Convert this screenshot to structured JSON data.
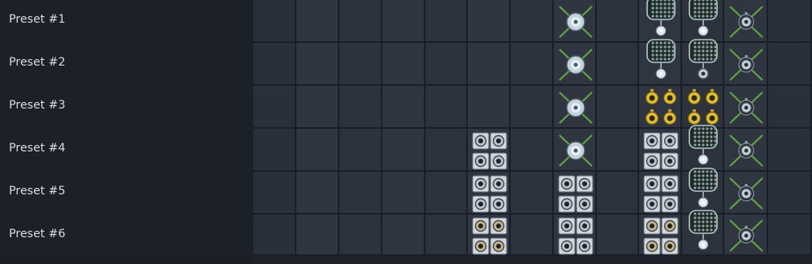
{
  "presets": [
    {
      "label": "Preset #1"
    },
    {
      "label": "Preset #2"
    },
    {
      "label": "Preset #3"
    },
    {
      "label": "Preset #4"
    },
    {
      "label": "Preset #5"
    },
    {
      "label": "Preset #6"
    }
  ],
  "placements": [
    {
      "col": 7,
      "row": 0,
      "icon": "x-knob"
    },
    {
      "col": 7,
      "row": 1,
      "icon": "x-knob"
    },
    {
      "col": 7,
      "row": 2,
      "icon": "x-knob"
    },
    {
      "col": 7,
      "row": 3,
      "icon": "x-knob"
    },
    {
      "col": 9,
      "row": 0,
      "icon": "grille"
    },
    {
      "col": 9,
      "row": 1,
      "icon": "grille"
    },
    {
      "col": 9,
      "row": 2,
      "icon": "yellow-jacks"
    },
    {
      "col": 9,
      "row": 3,
      "icon": "silver-jacks"
    },
    {
      "col": 9,
      "row": 4,
      "icon": "silver-jacks"
    },
    {
      "col": 9,
      "row": 5,
      "icon": "gold-jacks"
    },
    {
      "col": 10,
      "row": 0,
      "icon": "grille"
    },
    {
      "col": 10,
      "row": 1,
      "icon": "grille-ring"
    },
    {
      "col": 10,
      "row": 2,
      "icon": "yellow-jacks"
    },
    {
      "col": 10,
      "row": 3,
      "icon": "grille"
    },
    {
      "col": 10,
      "row": 4,
      "icon": "grille"
    },
    {
      "col": 10,
      "row": 5,
      "icon": "grille"
    },
    {
      "col": 11,
      "row": 0,
      "icon": "x-ring"
    },
    {
      "col": 11,
      "row": 1,
      "icon": "x-ring"
    },
    {
      "col": 11,
      "row": 2,
      "icon": "x-ring"
    },
    {
      "col": 11,
      "row": 3,
      "icon": "x-ring"
    },
    {
      "col": 11,
      "row": 4,
      "icon": "x-ring"
    },
    {
      "col": 11,
      "row": 5,
      "icon": "x-ring"
    },
    {
      "col": 5,
      "row": 3,
      "icon": "silver-jacks"
    },
    {
      "col": 5,
      "row": 4,
      "icon": "silver-jacks"
    },
    {
      "col": 5,
      "row": 5,
      "icon": "gold-jacks"
    },
    {
      "col": 7,
      "row": 4,
      "icon": "silver-jacks"
    },
    {
      "col": 7,
      "row": 5,
      "icon": "silver-jacks"
    }
  ]
}
